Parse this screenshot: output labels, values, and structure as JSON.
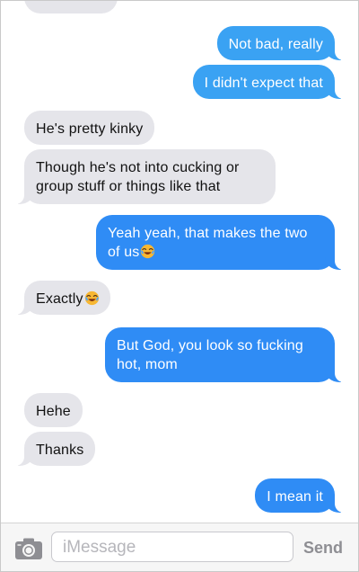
{
  "conversation": {
    "messages": [
      {
        "id": "m1",
        "direction": "incoming",
        "text": "",
        "cut_off": true
      },
      {
        "id": "m2",
        "direction": "outgoing",
        "text": "Not bad, really"
      },
      {
        "id": "m3",
        "direction": "outgoing",
        "text": "I didn't expect that"
      },
      {
        "id": "m4",
        "direction": "incoming",
        "text": "He's pretty kinky"
      },
      {
        "id": "m5",
        "direction": "incoming",
        "text": "Though he's not into cucking or group stuff or things like that"
      },
      {
        "id": "m6",
        "direction": "outgoing",
        "text": "Yeah yeah, that makes the two of us",
        "emoji": "laughing-face"
      },
      {
        "id": "m7",
        "direction": "incoming",
        "text": "Exactly",
        "emoji": "laughing-face"
      },
      {
        "id": "m8",
        "direction": "outgoing",
        "text": "But God, you look so fucking hot, mom"
      },
      {
        "id": "m9",
        "direction": "incoming",
        "text": "Hehe"
      },
      {
        "id": "m10",
        "direction": "incoming",
        "text": "Thanks"
      },
      {
        "id": "m11",
        "direction": "outgoing",
        "text": "I mean it"
      }
    ]
  },
  "composer": {
    "placeholder": "iMessage",
    "send_label": "Send",
    "camera_icon": "camera-icon"
  },
  "colors": {
    "incoming_bubble": "#e5e5ea",
    "outgoing_bubble": "#2f8cf5",
    "send_disabled": "#8e8e93"
  }
}
